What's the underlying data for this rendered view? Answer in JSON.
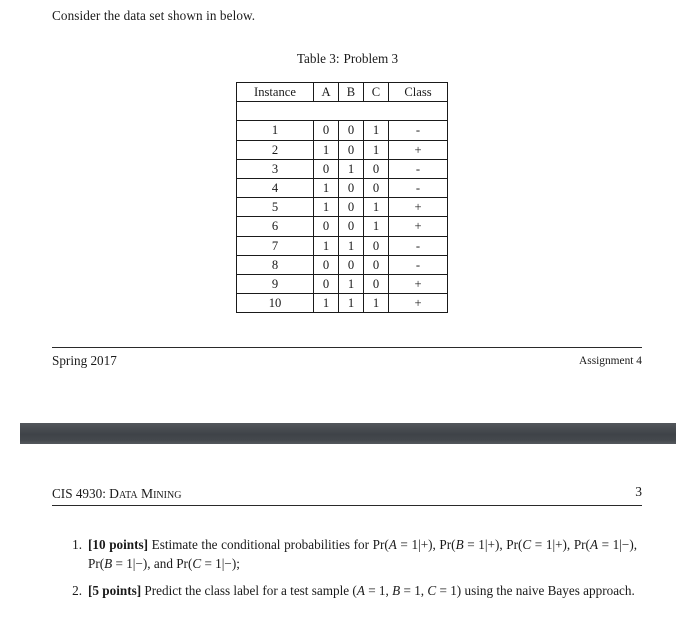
{
  "document": {
    "intro_text": "Consider the data set shown in below.",
    "table_caption_label": "Table 3:",
    "table_caption_title": "Problem 3"
  },
  "table": {
    "headers": [
      "Instance",
      "A",
      "B",
      "C",
      "Class"
    ],
    "rows": [
      {
        "instance": "1",
        "a": "0",
        "b": "0",
        "c": "1",
        "class": "-"
      },
      {
        "instance": "2",
        "a": "1",
        "b": "0",
        "c": "1",
        "class": "+"
      },
      {
        "instance": "3",
        "a": "0",
        "b": "1",
        "c": "0",
        "class": "-"
      },
      {
        "instance": "4",
        "a": "1",
        "b": "0",
        "c": "0",
        "class": "-"
      },
      {
        "instance": "5",
        "a": "1",
        "b": "0",
        "c": "1",
        "class": "+"
      },
      {
        "instance": "6",
        "a": "0",
        "b": "0",
        "c": "1",
        "class": "+"
      },
      {
        "instance": "7",
        "a": "1",
        "b": "1",
        "c": "0",
        "class": "-"
      },
      {
        "instance": "8",
        "a": "0",
        "b": "0",
        "c": "0",
        "class": "-"
      },
      {
        "instance": "9",
        "a": "0",
        "b": "1",
        "c": "0",
        "class": "+"
      },
      {
        "instance": "10",
        "a": "1",
        "b": "1",
        "c": "1",
        "class": "+"
      }
    ]
  },
  "page1_footer": {
    "left": "Spring 2017",
    "right": "Assignment 4"
  },
  "page2_header": {
    "course_code": "CIS 4930:",
    "course_name": "Data Mining",
    "page_number": "3"
  },
  "problems": [
    {
      "number": "1.",
      "points": "[10 points]",
      "text_part1": " Estimate the conditional probabilities for Pr(",
      "var1": "A",
      "text_part2": " = 1|+), Pr(",
      "var2": "B",
      "text_part3": " = 1|+), Pr(",
      "var3": "C",
      "text_part4": " = 1|+), Pr(",
      "var4": "A",
      "text_part5": " = 1|−), Pr(",
      "var5": "B",
      "text_part6": " = 1|−), and Pr(",
      "var6": "C",
      "text_part7": " = 1|−);"
    },
    {
      "number": "2.",
      "points": "[5 points]",
      "text_part1": " Predict the class label for a test sample (",
      "var1": "A",
      "text_part2": " = 1, ",
      "var2": "B",
      "text_part3": " = 1, ",
      "var3": "C",
      "text_part4": " = 1) using the naive Bayes approach."
    }
  ],
  "colors": {
    "text": "#1a1a1a",
    "rule": "#2a2a2a",
    "separator_bar": "#3f4348"
  }
}
